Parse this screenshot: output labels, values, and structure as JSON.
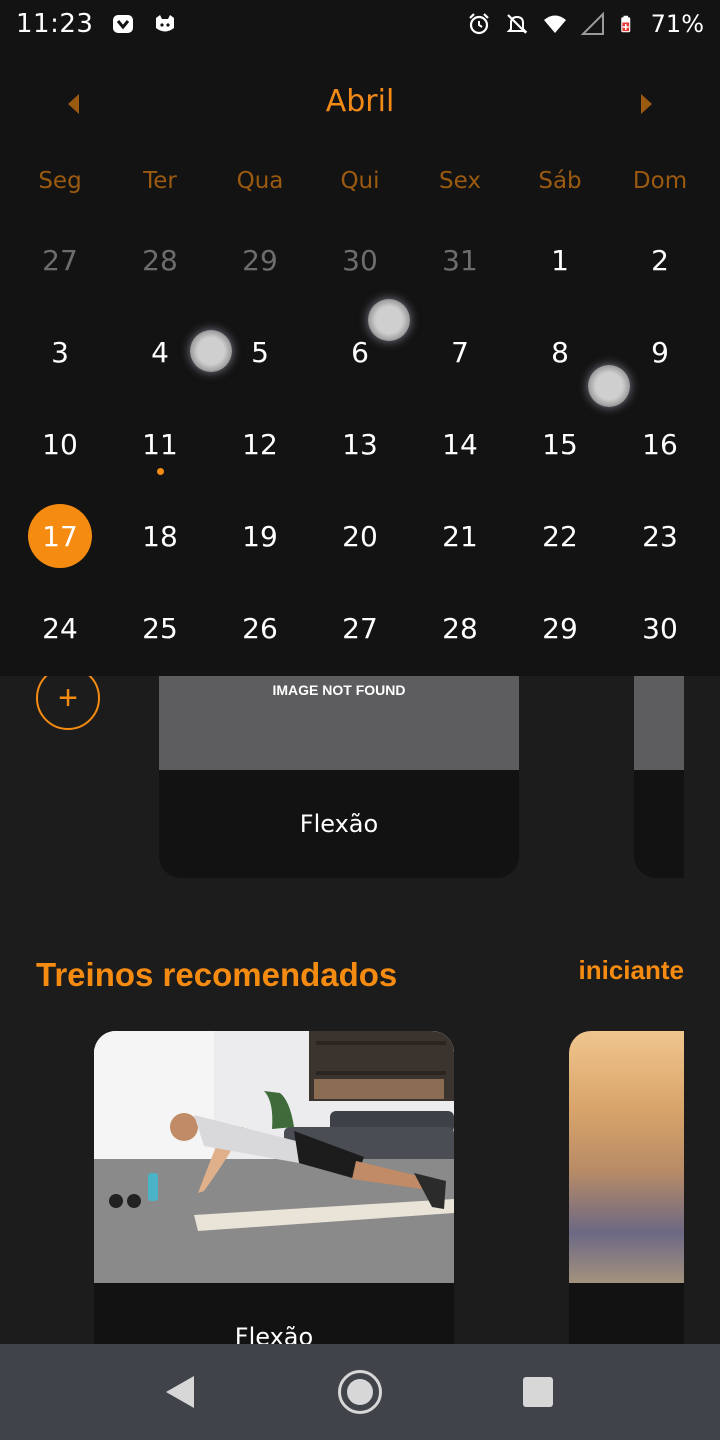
{
  "status_bar": {
    "time": "11:23",
    "battery_percent": "71%",
    "icons": [
      "app-notification-icon",
      "cat-notification-icon",
      "alarm-icon",
      "notifications-off-icon",
      "wifi-icon",
      "signal-icon",
      "battery-icon"
    ]
  },
  "calendar": {
    "month": "Abril",
    "weekdays": [
      "Seg",
      "Ter",
      "Qua",
      "Qui",
      "Sex",
      "Sáb",
      "Dom"
    ],
    "weeks": [
      [
        {
          "d": "27",
          "muted": true
        },
        {
          "d": "28",
          "muted": true
        },
        {
          "d": "29",
          "muted": true
        },
        {
          "d": "30",
          "muted": true
        },
        {
          "d": "31",
          "muted": true
        },
        {
          "d": "1"
        },
        {
          "d": "2"
        }
      ],
      [
        {
          "d": "3"
        },
        {
          "d": "4"
        },
        {
          "d": "5"
        },
        {
          "d": "6"
        },
        {
          "d": "7"
        },
        {
          "d": "8"
        },
        {
          "d": "9"
        }
      ],
      [
        {
          "d": "10"
        },
        {
          "d": "11",
          "dot": true
        },
        {
          "d": "12"
        },
        {
          "d": "13"
        },
        {
          "d": "14"
        },
        {
          "d": "15"
        },
        {
          "d": "16"
        }
      ],
      [
        {
          "d": "17",
          "selected": true
        },
        {
          "d": "18"
        },
        {
          "d": "19"
        },
        {
          "d": "20"
        },
        {
          "d": "21"
        },
        {
          "d": "22"
        },
        {
          "d": "23"
        }
      ],
      [
        {
          "d": "24"
        },
        {
          "d": "25"
        },
        {
          "d": "26"
        },
        {
          "d": "27"
        },
        {
          "d": "28"
        },
        {
          "d": "29"
        },
        {
          "d": "30"
        }
      ]
    ]
  },
  "exercises": {
    "add_label": "+",
    "cards": [
      {
        "image_text": "IMAGE NOT FOUND",
        "title": "Flexão"
      }
    ]
  },
  "recommended": {
    "title": "Treinos recomendados",
    "level": "iniciante",
    "cards": [
      {
        "title": "Flexão"
      }
    ]
  },
  "colors": {
    "accent": "#f58b10",
    "background": "#1c1c1c",
    "calendar_bg": "#131313",
    "nav_bar": "#40434a"
  }
}
